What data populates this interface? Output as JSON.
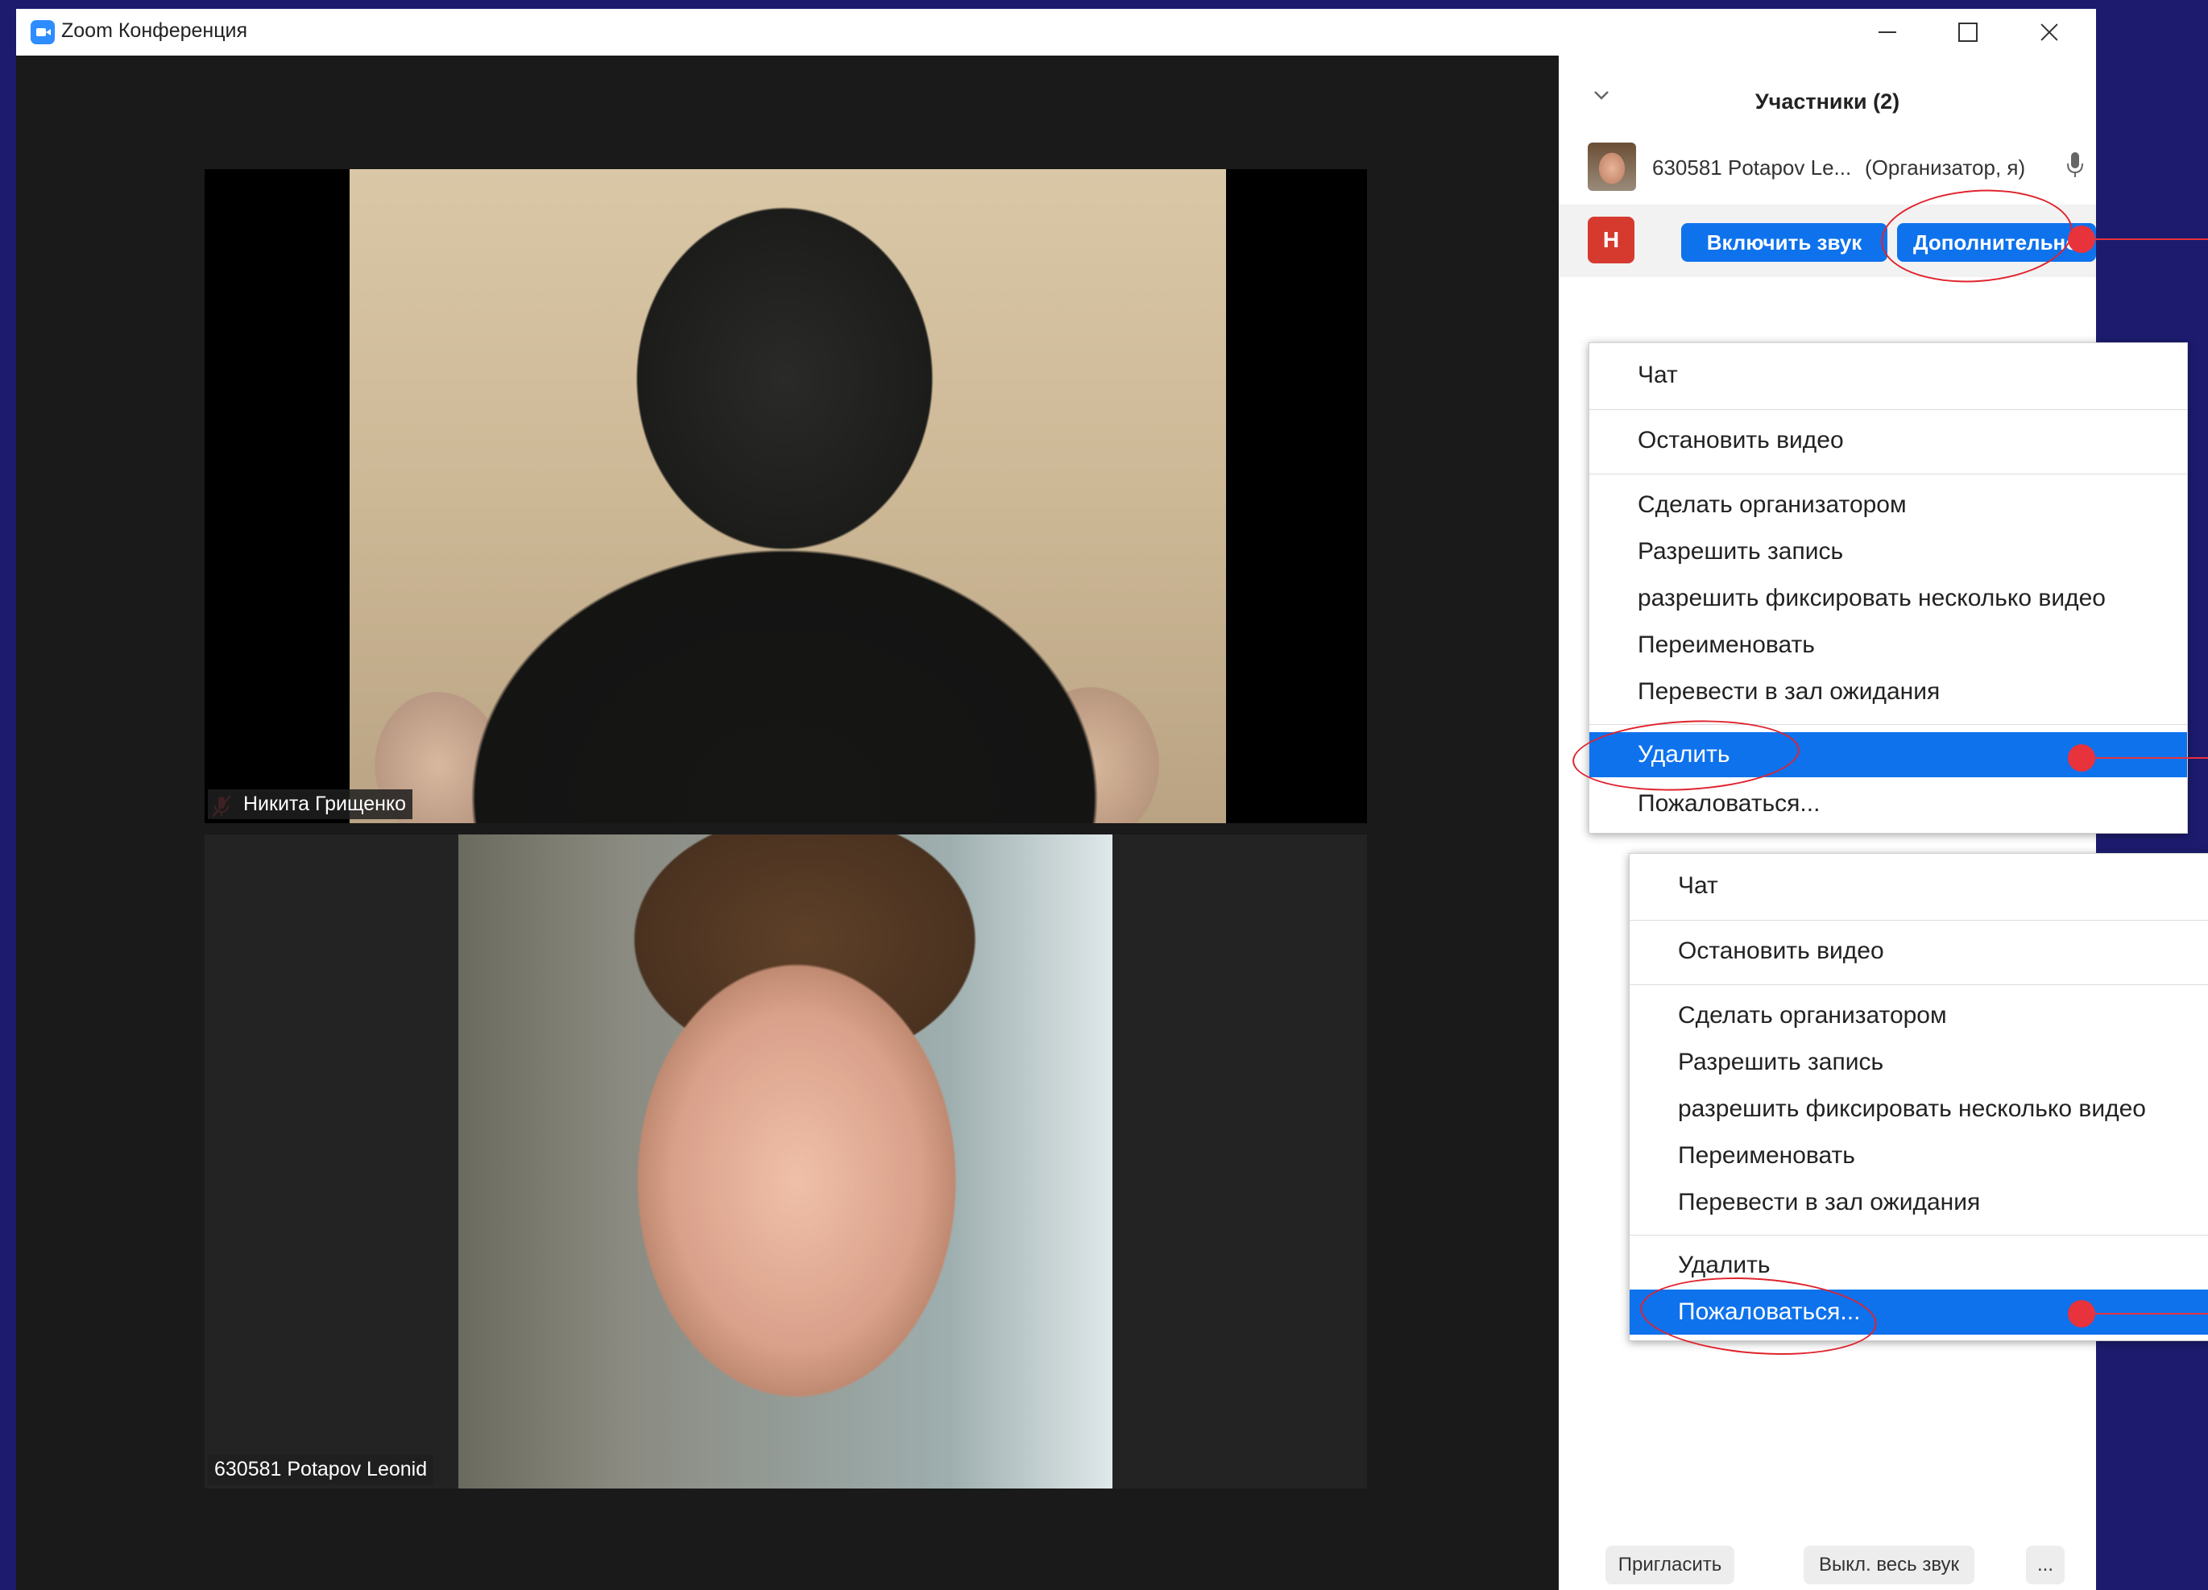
{
  "window": {
    "title": "Zoom Конференция"
  },
  "videos": [
    {
      "name": "Никита Грищенко",
      "muted": true
    },
    {
      "name": "630581 Potapov Leonid",
      "muted": false
    }
  ],
  "participants_panel": {
    "title": "Участники (2)",
    "participant": {
      "name": "630581 Potapov Le...",
      "role": "(Организатор, я)"
    },
    "hovered_participant": {
      "avatar_letter": "Н",
      "avatar_color": "#d63a2f",
      "unmute_label": "Включить звук",
      "more_label": "Дополнительно"
    },
    "footer": {
      "invite": "Пригласить",
      "mute_all": "Выкл. весь звук",
      "more": "..."
    }
  },
  "menus": [
    {
      "items": [
        "Чат",
        "Остановить видео",
        "Сделать организатором",
        "Разрешить запись",
        "разрешить фиксировать несколько видео",
        "Переименовать",
        "Перевести в зал ожидания",
        "Удалить",
        "Пожаловаться..."
      ],
      "selected": "Удалить"
    },
    {
      "items": [
        "Чат",
        "Остановить видео",
        "Сделать организатором",
        "Разрешить запись",
        "разрешить фиксировать несколько видео",
        "Переименовать",
        "Перевести в зал ожидания",
        "Удалить",
        "Пожаловаться..."
      ],
      "selected": "Пожаловаться..."
    }
  ],
  "colors": {
    "accent": "#0e72ed",
    "annotation": "#e8323c",
    "background": "#1c1b6e"
  }
}
